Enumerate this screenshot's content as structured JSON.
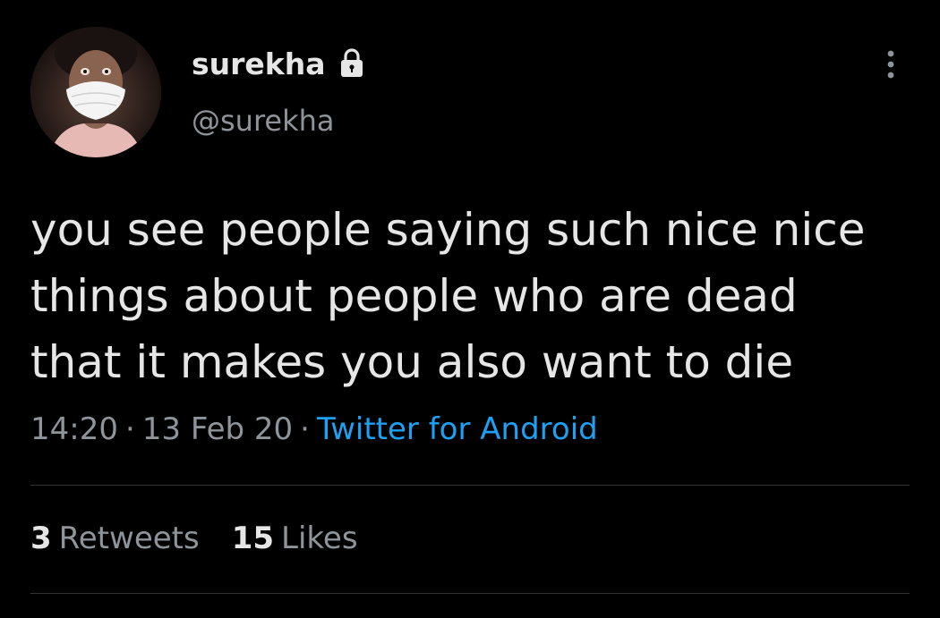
{
  "tweet": {
    "display_name": "surekha",
    "handle": "@surekha",
    "text": "you see people saying such nice nice\nthings about people who are dead\nthat it makes you also want to die",
    "time": "14:20",
    "date": "13 Feb 20",
    "separator": "·",
    "source": "Twitter for Android"
  },
  "stats": {
    "retweets_count": "3",
    "retweets_label": "Retweets",
    "likes_count": "15",
    "likes_label": "Likes"
  },
  "icons": {
    "protected": "lock-icon",
    "more": "more-vertical-icon"
  },
  "colors": {
    "background": "#000000",
    "text": "#e6e6e6",
    "secondary": "#8e949a",
    "link": "#1da1f2",
    "divider": "#2f3336"
  }
}
